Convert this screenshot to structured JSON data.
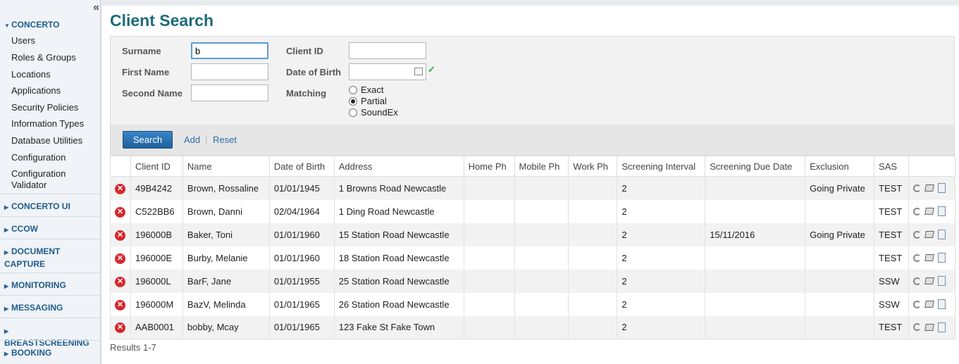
{
  "sidebar": {
    "collapse_glyph": "«",
    "sections": [
      {
        "label": "CONCERTO",
        "expanded": true,
        "items": [
          "Users",
          "Roles & Groups",
          "Locations",
          "Applications",
          "Security Policies",
          "Information Types",
          "Database Utilities",
          "Configuration",
          "Configuration Validator"
        ]
      },
      {
        "label": "CONCERTO UI",
        "expanded": false
      },
      {
        "label": "CCOW",
        "expanded": false
      },
      {
        "label": "DOCUMENT CAPTURE",
        "expanded": false
      },
      {
        "label": "MONITORING",
        "expanded": false
      },
      {
        "label": "MESSAGING",
        "expanded": false
      },
      {
        "label": "BREASTSCREENING",
        "expanded": false
      },
      {
        "label": "BOOKING",
        "expanded": false
      }
    ]
  },
  "page": {
    "title": "Client Search"
  },
  "form": {
    "surname_label": "Surname",
    "surname_value": "b",
    "first_name_label": "First Name",
    "first_name_value": "",
    "second_name_label": "Second Name",
    "second_name_value": "",
    "client_id_label": "Client ID",
    "client_id_value": "",
    "dob_label": "Date of Birth",
    "dob_value": "",
    "matching_label": "Matching",
    "matching_options": [
      "Exact",
      "Partial",
      "SoundEx"
    ],
    "matching_selected": "Partial"
  },
  "actions": {
    "search": "Search",
    "add": "Add",
    "sep": "|",
    "reset": "Reset"
  },
  "table": {
    "headers": [
      "",
      "Client ID",
      "Name",
      "Date of Birth",
      "Address",
      "Home Ph",
      "Mobile Ph",
      "Work Ph",
      "Screening Interval",
      "Screening Due Date",
      "Exclusion",
      "SAS",
      ""
    ],
    "rows": [
      {
        "client_id": "49B4242",
        "name": "Brown, Rossaline",
        "dob": "01/01/1945",
        "address": "1 Browns Road Newcastle",
        "home_ph": "",
        "mobile_ph": "",
        "work_ph": "",
        "interval": "2",
        "due_date": "",
        "exclusion": "Going Private",
        "sas": "TEST"
      },
      {
        "client_id": "C522BB6",
        "name": "Brown, Danni",
        "dob": "02/04/1964",
        "address": "1 Ding Road Newcastle",
        "home_ph": "",
        "mobile_ph": "",
        "work_ph": "",
        "interval": "2",
        "due_date": "",
        "exclusion": "",
        "sas": "TEST"
      },
      {
        "client_id": "196000B",
        "name": "Baker, Toni",
        "dob": "01/01/1960",
        "address": "15 Station Road Newcastle",
        "home_ph": "",
        "mobile_ph": "",
        "work_ph": "",
        "interval": "2",
        "due_date": "15/11/2016",
        "exclusion": "Going Private",
        "sas": "TEST"
      },
      {
        "client_id": "196000E",
        "name": "Burby, Melanie",
        "dob": "01/01/1960",
        "address": "18 Station Road Newcastle",
        "home_ph": "",
        "mobile_ph": "",
        "work_ph": "",
        "interval": "2",
        "due_date": "",
        "exclusion": "",
        "sas": "TEST"
      },
      {
        "client_id": "196000L",
        "name": "BarF, Jane",
        "dob": "01/01/1955",
        "address": "25 Station Road Newcastle",
        "home_ph": "",
        "mobile_ph": "",
        "work_ph": "",
        "interval": "2",
        "due_date": "",
        "exclusion": "",
        "sas": "SSW"
      },
      {
        "client_id": "196000M",
        "name": "BazV, Melinda",
        "dob": "01/01/1965",
        "address": "26 Station Road Newcastle",
        "home_ph": "",
        "mobile_ph": "",
        "work_ph": "",
        "interval": "2",
        "due_date": "",
        "exclusion": "",
        "sas": "SSW"
      },
      {
        "client_id": "AAB0001",
        "name": "bobby, Mcay",
        "dob": "01/01/1965",
        "address": "123 Fake St Fake Town",
        "home_ph": "",
        "mobile_ph": "",
        "work_ph": "",
        "interval": "2",
        "due_date": "",
        "exclusion": "",
        "sas": "TEST"
      }
    ]
  },
  "results_text": "Results 1-7",
  "colors": {
    "title": "#1c6b7a",
    "nav": "#1e5c8c",
    "link": "#2a6ea8",
    "search_button": "#1f5f9c",
    "delete": "#d9262c",
    "valid": "#2eaa3a"
  }
}
